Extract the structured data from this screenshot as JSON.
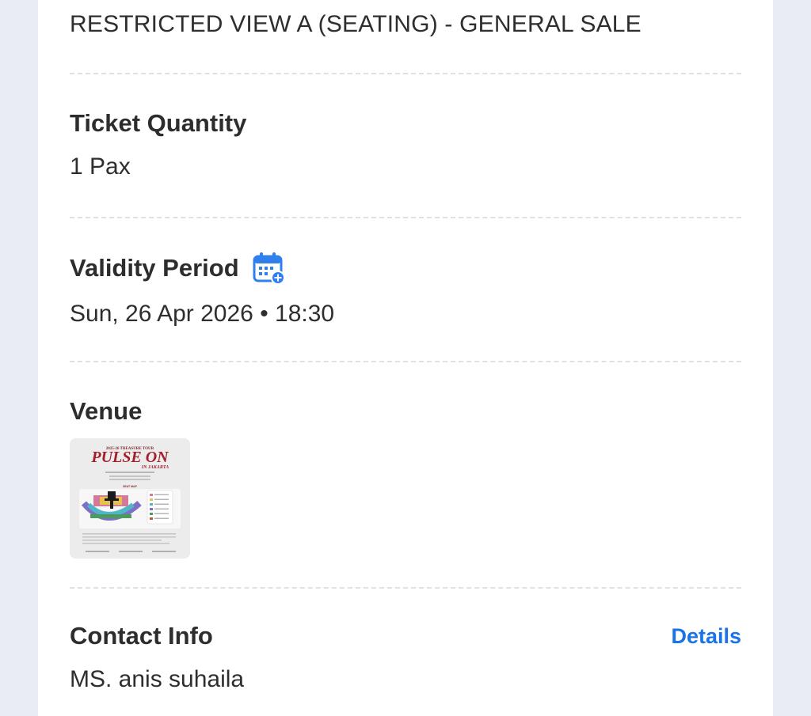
{
  "ticket": {
    "type": "RESTRICTED VIEW A (SEATING) - GENERAL SALE"
  },
  "quantity": {
    "label": "Ticket Quantity",
    "value": "1 Pax"
  },
  "validity": {
    "label": "Validity Period",
    "value": "Sun, 26 Apr 2026 • 18:30",
    "icon": "calendar-add-icon"
  },
  "venue": {
    "label": "Venue",
    "image_icon": "venue-map-thumbnail",
    "poster_title": "PULSE ON",
    "poster_subtitle": "IN JAKARTA",
    "poster_top": "2025-26 TREASURE TOUR",
    "poster_map_label": "SEAT MAP"
  },
  "contact": {
    "label": "Contact Info",
    "details_label": "Details",
    "value": "MS. anis suhaila"
  },
  "colors": {
    "background": "#e9ecf2",
    "card": "#ffffff",
    "text": "#2b2b2b",
    "link": "#1a73e8",
    "divider": "#dde1ea",
    "icon_blue": "#2f80ed"
  }
}
